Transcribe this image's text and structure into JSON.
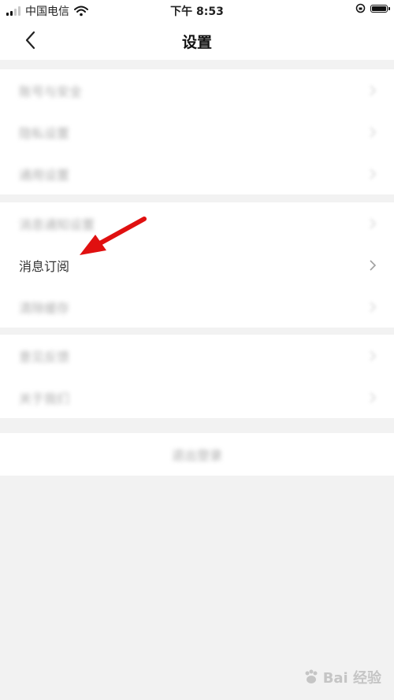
{
  "status_bar": {
    "carrier": "中国电信",
    "time": "下午 8:53"
  },
  "nav": {
    "title": "设置"
  },
  "groups": [
    {
      "items": [
        {
          "label": "账号与安全",
          "blurred": true
        },
        {
          "label": "隐私设置",
          "blurred": true
        },
        {
          "label": "通用设置",
          "blurred": true
        }
      ]
    },
    {
      "items": [
        {
          "label": "消息通知设置",
          "blurred": true
        },
        {
          "label": "消息订阅",
          "blurred": false
        },
        {
          "label": "清除缓存",
          "blurred": true
        }
      ]
    },
    {
      "items": [
        {
          "label": "意见反馈",
          "blurred": true
        },
        {
          "label": "关于我们",
          "blurred": true
        }
      ]
    }
  ],
  "logout": {
    "label": "退出登录"
  },
  "watermark": {
    "text": "Bai 经验"
  },
  "colors": {
    "background": "#f2f2f2",
    "card": "#ffffff",
    "arrow": "#e01010"
  },
  "icons": {
    "back": "chevron-left-icon",
    "row": "chevron-right-icon",
    "wifi": "wifi-icon",
    "battery": "battery-icon",
    "lock": "rotation-lock-icon"
  }
}
